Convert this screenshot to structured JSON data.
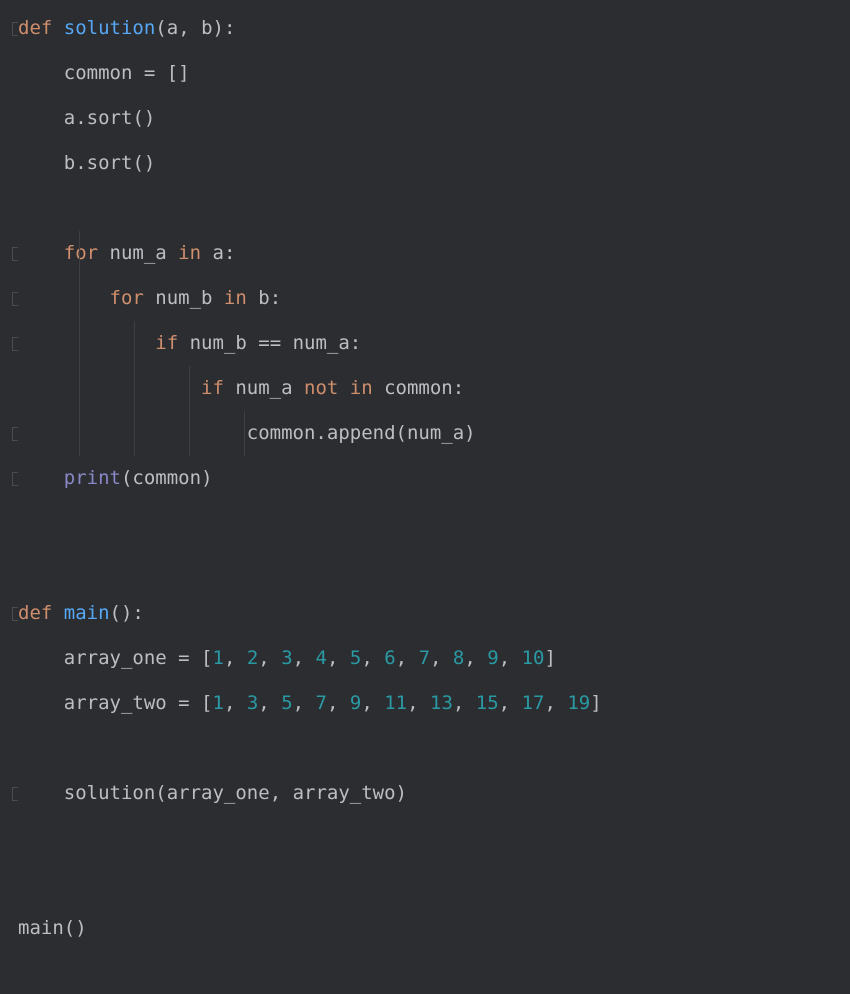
{
  "code": {
    "lines": [
      {
        "gutter": true,
        "tokens": [
          [
            "kw",
            "def "
          ],
          [
            "fn",
            "solution"
          ],
          [
            "pn",
            "("
          ],
          [
            "id",
            "a"
          ],
          [
            "pn",
            ", "
          ],
          [
            "id",
            "b"
          ],
          [
            "pn",
            "):"
          ]
        ]
      },
      {
        "indent": 1,
        "tokens": [
          [
            "id",
            "common "
          ],
          [
            "op",
            "= "
          ],
          [
            "pn",
            "[]"
          ]
        ]
      },
      {
        "indent": 1,
        "tokens": [
          [
            "id",
            "a"
          ],
          [
            "pn",
            "."
          ],
          [
            "id",
            "sort"
          ],
          [
            "pn",
            "()"
          ]
        ]
      },
      {
        "indent": 1,
        "tokens": [
          [
            "id",
            "b"
          ],
          [
            "pn",
            "."
          ],
          [
            "id",
            "sort"
          ],
          [
            "pn",
            "()"
          ]
        ]
      },
      {
        "blank": true
      },
      {
        "gutter": true,
        "indent": 1,
        "guides": [
          1
        ],
        "tokens": [
          [
            "kw",
            "for "
          ],
          [
            "id",
            "num_a "
          ],
          [
            "kw",
            "in "
          ],
          [
            "id",
            "a"
          ],
          [
            "pn",
            ":"
          ]
        ]
      },
      {
        "gutter": true,
        "indent": 2,
        "guides": [
          1
        ],
        "tokens": [
          [
            "kw",
            "for "
          ],
          [
            "id",
            "num_b "
          ],
          [
            "kw",
            "in "
          ],
          [
            "id",
            "b"
          ],
          [
            "pn",
            ":"
          ]
        ]
      },
      {
        "gutter": true,
        "indent": 3,
        "guides": [
          1,
          2
        ],
        "tokens": [
          [
            "kw",
            "if "
          ],
          [
            "id",
            "num_b "
          ],
          [
            "op",
            "== "
          ],
          [
            "id",
            "num_a"
          ],
          [
            "pn",
            ":"
          ]
        ]
      },
      {
        "indent": 4,
        "guides": [
          1,
          2,
          3
        ],
        "tokens": [
          [
            "kw",
            "if "
          ],
          [
            "id",
            "num_a "
          ],
          [
            "kw",
            "not in "
          ],
          [
            "id",
            "common"
          ],
          [
            "pn",
            ":"
          ]
        ]
      },
      {
        "gutter": true,
        "indent": 5,
        "guides": [
          1,
          2,
          3,
          4
        ],
        "tokens": [
          [
            "id",
            "common"
          ],
          [
            "pn",
            "."
          ],
          [
            "id",
            "append"
          ],
          [
            "pn",
            "("
          ],
          [
            "id",
            "num_a"
          ],
          [
            "pn",
            ")"
          ]
        ]
      },
      {
        "gutter": true,
        "indent": 1,
        "tokens": [
          [
            "builtin",
            "print"
          ],
          [
            "pn",
            "("
          ],
          [
            "id",
            "common"
          ],
          [
            "pn",
            ")"
          ]
        ]
      },
      {
        "blank": true
      },
      {
        "blank": true
      },
      {
        "gutter": true,
        "tokens": [
          [
            "kw",
            "def "
          ],
          [
            "fn",
            "main"
          ],
          [
            "pn",
            "():"
          ]
        ]
      },
      {
        "indent": 1,
        "tokens": [
          [
            "id",
            "array_one "
          ],
          [
            "op",
            "= "
          ],
          [
            "pn",
            "["
          ],
          [
            "num",
            "1"
          ],
          [
            "pn",
            ", "
          ],
          [
            "num",
            "2"
          ],
          [
            "pn",
            ", "
          ],
          [
            "num",
            "3"
          ],
          [
            "pn",
            ", "
          ],
          [
            "num",
            "4"
          ],
          [
            "pn",
            ", "
          ],
          [
            "num",
            "5"
          ],
          [
            "pn",
            ", "
          ],
          [
            "num",
            "6"
          ],
          [
            "pn",
            ", "
          ],
          [
            "num",
            "7"
          ],
          [
            "pn",
            ", "
          ],
          [
            "num",
            "8"
          ],
          [
            "pn",
            ", "
          ],
          [
            "num",
            "9"
          ],
          [
            "pn",
            ", "
          ],
          [
            "num",
            "10"
          ],
          [
            "pn",
            "]"
          ]
        ]
      },
      {
        "indent": 1,
        "tokens": [
          [
            "id",
            "array_two "
          ],
          [
            "op",
            "= "
          ],
          [
            "pn",
            "["
          ],
          [
            "num",
            "1"
          ],
          [
            "pn",
            ", "
          ],
          [
            "num",
            "3"
          ],
          [
            "pn",
            ", "
          ],
          [
            "num",
            "5"
          ],
          [
            "pn",
            ", "
          ],
          [
            "num",
            "7"
          ],
          [
            "pn",
            ", "
          ],
          [
            "num",
            "9"
          ],
          [
            "pn",
            ", "
          ],
          [
            "num",
            "11"
          ],
          [
            "pn",
            ", "
          ],
          [
            "num",
            "13"
          ],
          [
            "pn",
            ", "
          ],
          [
            "num",
            "15"
          ],
          [
            "pn",
            ", "
          ],
          [
            "num",
            "17"
          ],
          [
            "pn",
            ", "
          ],
          [
            "num",
            "19"
          ],
          [
            "pn",
            "]"
          ]
        ]
      },
      {
        "blank": true
      },
      {
        "gutter": true,
        "indent": 1,
        "tokens": [
          [
            "id",
            "solution"
          ],
          [
            "pn",
            "("
          ],
          [
            "id",
            "array_one"
          ],
          [
            "pn",
            ", "
          ],
          [
            "id",
            "array_two"
          ],
          [
            "pn",
            ")"
          ]
        ]
      },
      {
        "blank": true
      },
      {
        "blank": true
      },
      {
        "tokens": [
          [
            "id",
            "main"
          ],
          [
            "pn",
            "()"
          ]
        ]
      }
    ],
    "indent_unit": "    "
  }
}
